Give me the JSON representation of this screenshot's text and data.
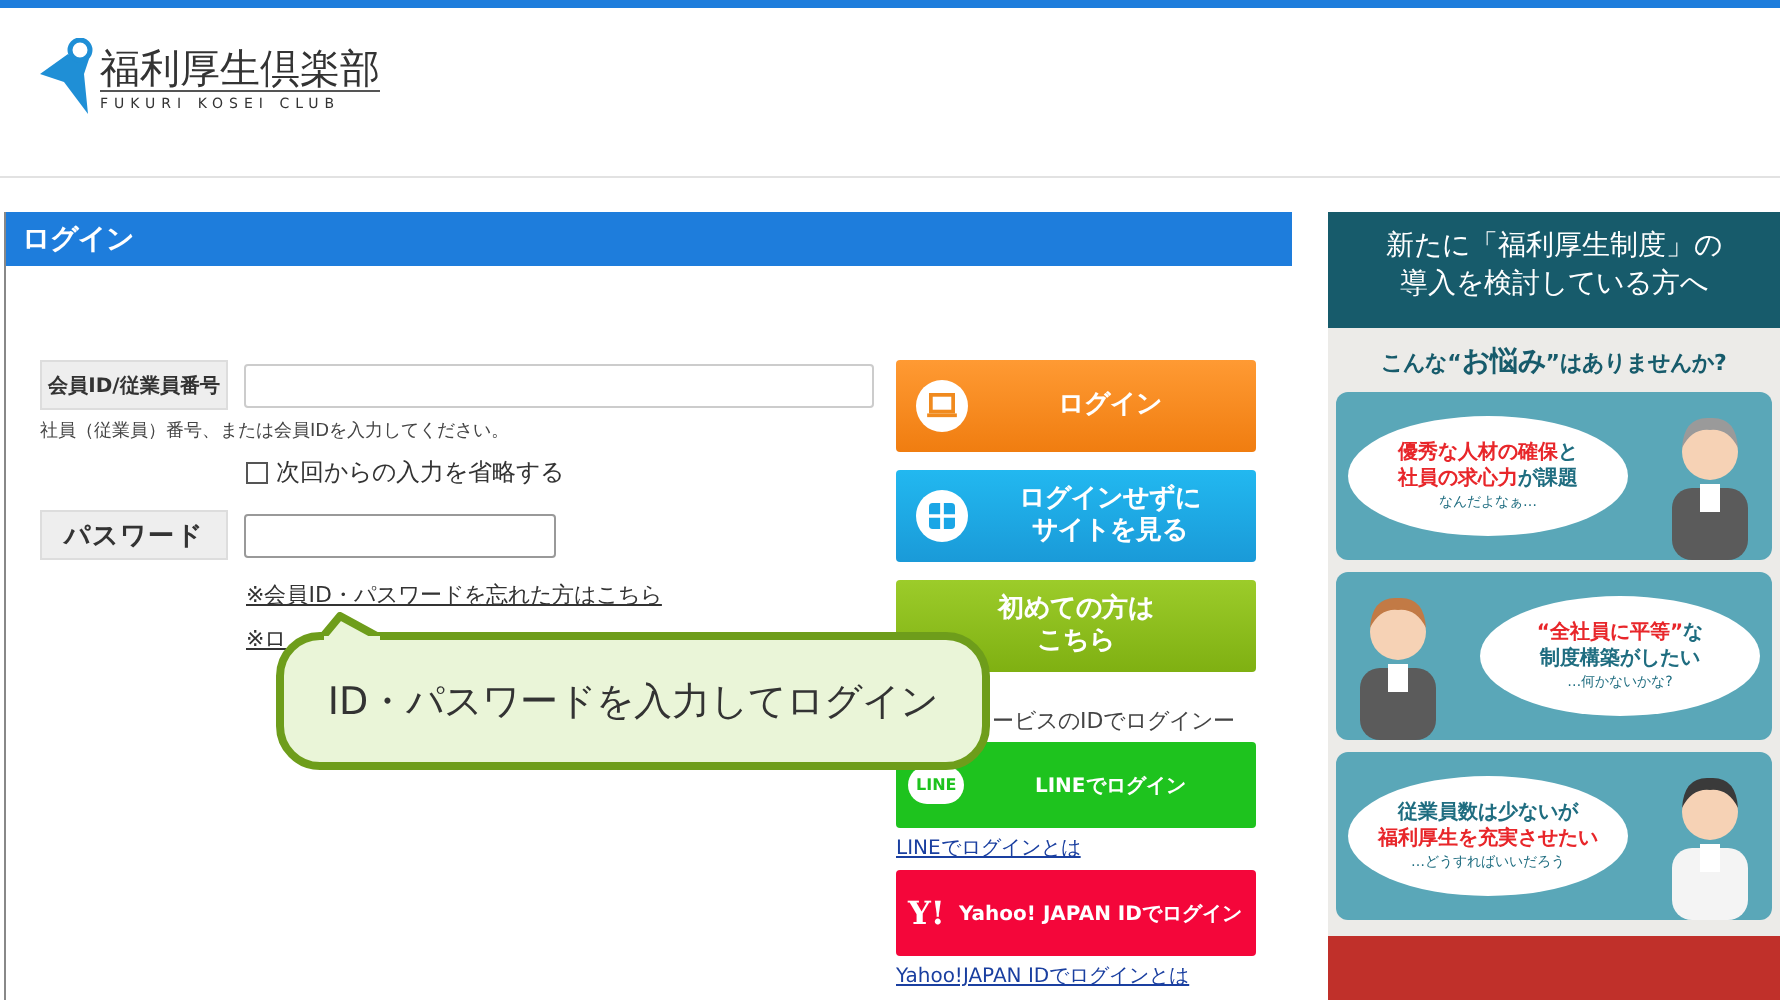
{
  "logo": {
    "name": "福利厚生倶楽部",
    "subtitle": "FUKURI KOSEI CLUB"
  },
  "login": {
    "title": "ログイン",
    "id_field": {
      "label": "会員ID/従業員番号",
      "hint": "社員（従業員）番号、または会員IDを入力してください。"
    },
    "remember": {
      "label": "次回からの入力を省略する",
      "checked": false
    },
    "password_field": {
      "label": "パスワード"
    },
    "links": [
      "※会員ID・パスワードを忘れた方はこちら",
      "※ロ"
    ],
    "buttons": [
      {
        "label": "ログイン",
        "kind": "orange"
      },
      {
        "label": "ログインせずに",
        "label_line_2": "サイトを見る",
        "kind": "blue"
      },
      {
        "label": "初めての方は",
        "label_line_2": "こちら",
        "kind": "green"
      }
    ],
    "other_services_caption": "ービスのIDでログインー",
    "service_logins": [
      {
        "label": "LINEでログイン",
        "kind": "line",
        "badge": "LINE",
        "help_link": "LINEでログインとは"
      },
      {
        "label": "Yahoo! JAPAN IDでログイン",
        "kind": "yahoo",
        "badge": "Y!",
        "help_link": "Yahoo!JAPAN IDでログインとは"
      }
    ]
  },
  "promo": {
    "title_lines": [
      "新たに「福利厚生制度」の",
      "導入を検討している方へ"
    ],
    "subtitle": "こんな“**お悩み**”はありませんか?",
    "cards": [
      {
        "lines": [
          "**優秀な人材の確保**と",
          "**社員の求心力**が課題"
        ],
        "aside": "なんだよなぁ…"
      },
      {
        "lines": [
          "**“全社員に平等”**な",
          "制度構築がしたい"
        ],
        "aside": "…何かないかな?"
      },
      {
        "lines": [
          "従業員数は少ないが",
          "**福利厚生を充実させたい**"
        ],
        "aside": "…どうすればいいだろう"
      }
    ]
  },
  "callout": {
    "text": "ID・パスワードを入力してログイン"
  }
}
